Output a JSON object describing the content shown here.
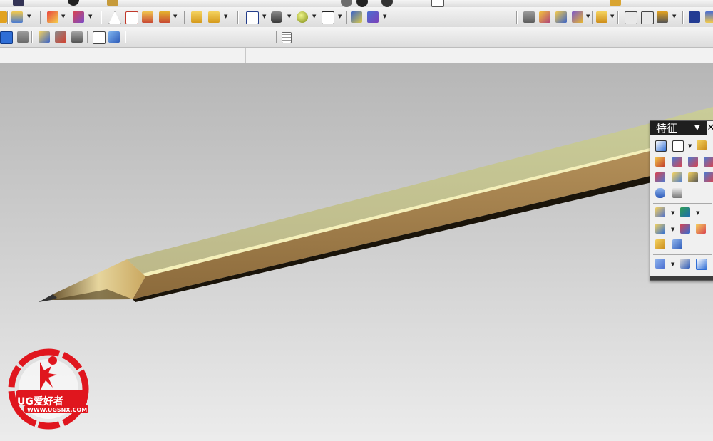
{
  "feature_panel": {
    "title": "特征",
    "dropdown_glyph": "▼",
    "close_glyph": "✕"
  },
  "watermark": {
    "brand": "UG爱好者",
    "url": "WWW.UGSNX.COM"
  },
  "colors": {
    "viewport_top": "#b6b6b6",
    "viewport_bottom": "#ebebeb",
    "pencil_body_light": "#d9d4a0",
    "pencil_body_mid": "#a8884f",
    "pencil_body_dark": "#6e5128",
    "logo_red": "#e0161e",
    "panel_title_bg": "#1f1f1f"
  },
  "toolbar": {
    "row1_icons": [
      "part-icon",
      "block-icon",
      "cylinder-icon",
      "triangle-icon",
      "sheet-icon",
      "shade-icon",
      "group-icon",
      "feature-icon",
      "feature-icon-2",
      "window-icon",
      "plane-icon",
      "sphere-icon",
      "square-icon",
      "layer-icon",
      "arrow-icon",
      "view-icon",
      "move-icon",
      "align-icon",
      "palette-icon",
      "curve-icon",
      "measure-icon",
      "tree-icon",
      "snap-icon",
      "help-icon"
    ],
    "row2_icons": [
      "select-icon",
      "filter-icon",
      "point-icon",
      "snap-icon",
      "wrench-icon",
      "box-icon",
      "cube-icon",
      "line-icon",
      "line-icon-2",
      "arc-icon",
      "tangent-icon",
      "circle-icon",
      "center-icon",
      "plus-icon",
      "slash-icon",
      "patch-icon",
      "grid-icon"
    ]
  },
  "feature_icons": [
    "sketch-icon",
    "datum-icon",
    "extrude-icon",
    "revolve-icon",
    "block-icon",
    "cylinder-icon",
    "cone-icon",
    "sphere-icon",
    "hole-icon",
    "boss-icon",
    "pocket-icon",
    "pad-icon",
    "slot-icon",
    "groove-icon",
    "unite-icon",
    "subtract-icon",
    "edge-blend-icon",
    "chamfer-icon",
    "shell-icon",
    "draft-icon",
    "offset-icon",
    "trim-icon",
    "mirror-icon",
    "pattern-icon"
  ]
}
